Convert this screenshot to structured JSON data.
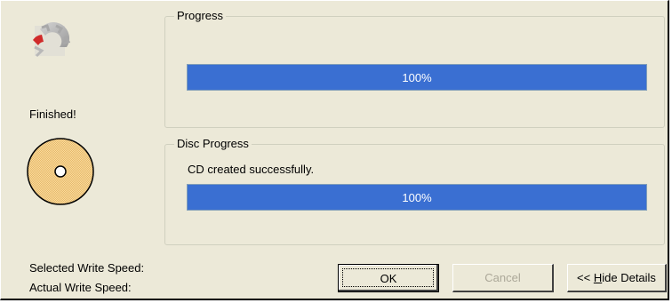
{
  "status": {
    "label": "Finished!"
  },
  "progress_group": {
    "title": "Progress",
    "percent_text": "100%",
    "value": 1.0
  },
  "disc_group": {
    "title": "Disc Progress",
    "message": "CD created successfully.",
    "percent_text": "100%",
    "value": 1.0
  },
  "speeds": {
    "selected_label": "Selected Write Speed:",
    "actual_label": "Actual Write Speed:"
  },
  "buttons": {
    "ok_label": "OK",
    "cancel_label": "Cancel",
    "hide_prefix": "<< ",
    "hide_mnemonic": "H",
    "hide_rest": "ide Details"
  },
  "colors": {
    "progress_fill": "#3a6fd2",
    "dialog_bg": "#ece9d8",
    "disc_fill": "#f6d597"
  },
  "icons": {
    "app": "burning-gear-icon",
    "disc": "cd-disc-icon"
  }
}
